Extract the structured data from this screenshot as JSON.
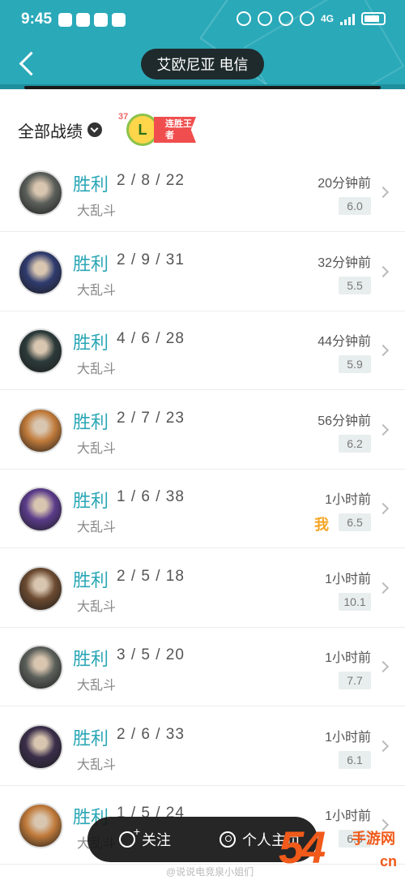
{
  "status_bar": {
    "time": "9:45",
    "network": "4G"
  },
  "header": {
    "title": "艾欧尼亚 电信"
  },
  "section": {
    "title": "全部战绩",
    "badge_number": "37",
    "badge_letter": "L",
    "badge_text": "连胜王者"
  },
  "matches": [
    {
      "result": "胜利",
      "kda": "2 / 8 / 22",
      "mode": "大乱斗",
      "time": "20分钟前",
      "score": "6.0",
      "avatar_color": "#5b5f5a",
      "me": ""
    },
    {
      "result": "胜利",
      "kda": "2 / 9 / 31",
      "mode": "大乱斗",
      "time": "32分钟前",
      "score": "5.5",
      "avatar_color": "#2f3b6e",
      "me": ""
    },
    {
      "result": "胜利",
      "kda": "4 / 6 / 28",
      "mode": "大乱斗",
      "time": "44分钟前",
      "score": "5.9",
      "avatar_color": "#2c3a3a",
      "me": ""
    },
    {
      "result": "胜利",
      "kda": "2 / 7 / 23",
      "mode": "大乱斗",
      "time": "56分钟前",
      "score": "6.2",
      "avatar_color": "#c07a3a",
      "me": ""
    },
    {
      "result": "胜利",
      "kda": "1 / 6 / 38",
      "mode": "大乱斗",
      "time": "1小时前",
      "score": "6.5",
      "avatar_color": "#5a3b8a",
      "me": "我"
    },
    {
      "result": "胜利",
      "kda": "2 / 5 / 18",
      "mode": "大乱斗",
      "time": "1小时前",
      "score": "10.1",
      "avatar_color": "#6b4a30",
      "me": ""
    },
    {
      "result": "胜利",
      "kda": "3 / 5 / 20",
      "mode": "大乱斗",
      "time": "1小时前",
      "score": "7.7",
      "avatar_color": "#5b5f5a",
      "me": ""
    },
    {
      "result": "胜利",
      "kda": "2 / 6 / 33",
      "mode": "大乱斗",
      "time": "1小时前",
      "score": "6.1",
      "avatar_color": "#3a2e4a",
      "me": ""
    },
    {
      "result": "胜利",
      "kda": "1 / 5 / 24",
      "mode": "大乱斗",
      "time": "1小时前",
      "score": "6.3",
      "avatar_color": "#c07a3a",
      "me": ""
    }
  ],
  "bottom_bar": {
    "follow_label": "关注",
    "profile_label": "个人主页"
  },
  "watermark": "@说说电竞泉小姐们",
  "site_logo": {
    "number": "54",
    "name": "手游网",
    "url": "cn"
  }
}
